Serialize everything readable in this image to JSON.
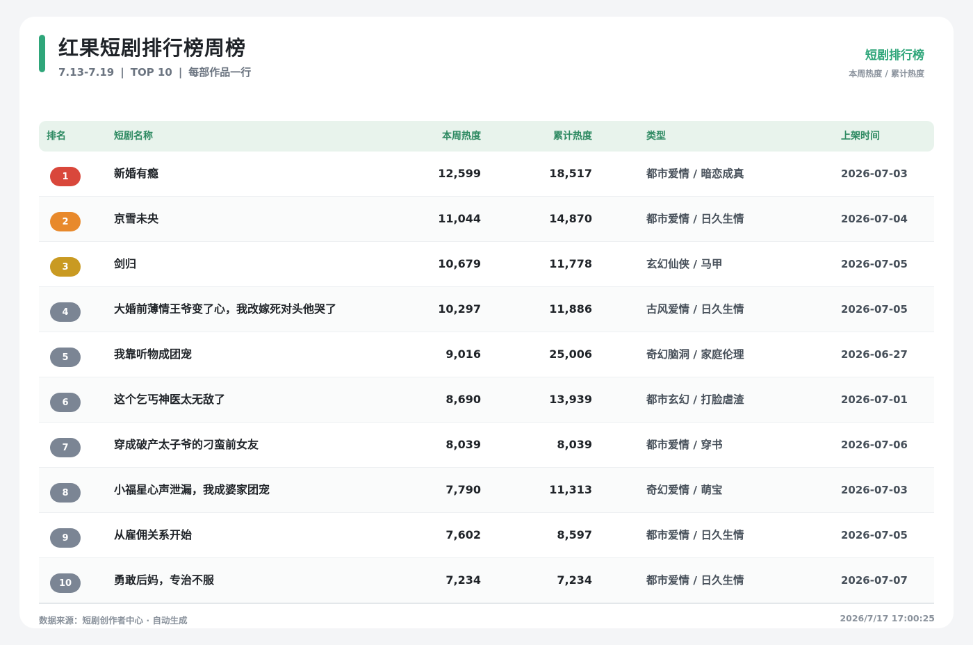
{
  "header": {
    "title": "红果短剧排行榜周榜",
    "period": "7.13-7.19",
    "scope": "TOP 10",
    "note": "每部作品一行",
    "separator": "|",
    "brand": "短剧排行榜",
    "brand_sub": "本周热度 / 累计热度"
  },
  "table": {
    "columns": {
      "rank": "排名",
      "name": "短剧名称",
      "weekly": "本周热度",
      "total": "累计热度",
      "genre": "类型",
      "date": "上架时间"
    },
    "rows": [
      {
        "rank": "1",
        "name": "新婚有瘾",
        "weekly": "12,599",
        "total": "18,517",
        "genre": "都市爱情 / 暗恋成真",
        "date": "2026-07-03",
        "badge_color": "#d9473b"
      },
      {
        "rank": "2",
        "name": "京雪未央",
        "weekly": "11,044",
        "total": "14,870",
        "genre": "都市爱情 / 日久生情",
        "date": "2026-07-04",
        "badge_color": "#e8892b"
      },
      {
        "rank": "3",
        "name": "剑归",
        "weekly": "10,679",
        "total": "11,778",
        "genre": "玄幻仙侠 / 马甲",
        "date": "2026-07-05",
        "badge_color": "#c99a22"
      },
      {
        "rank": "4",
        "name": "大婚前薄情王爷变了心，我改嫁死对头他哭了",
        "weekly": "10,297",
        "total": "11,886",
        "genre": "古风爱情 / 日久生情",
        "date": "2026-07-05",
        "badge_color": "#7b8594"
      },
      {
        "rank": "5",
        "name": "我靠听物成团宠",
        "weekly": "9,016",
        "total": "25,006",
        "genre": "奇幻脑洞 / 家庭伦理",
        "date": "2026-06-27",
        "badge_color": "#7b8594"
      },
      {
        "rank": "6",
        "name": "这个乞丐神医太无敌了",
        "weekly": "8,690",
        "total": "13,939",
        "genre": "都市玄幻 / 打脸虐渣",
        "date": "2026-07-01",
        "badge_color": "#7b8594"
      },
      {
        "rank": "7",
        "name": "穿成破产太子爷的刁蛮前女友",
        "weekly": "8,039",
        "total": "8,039",
        "genre": "都市爱情 / 穿书",
        "date": "2026-07-06",
        "badge_color": "#7b8594"
      },
      {
        "rank": "8",
        "name": "小福星心声泄漏，我成婆家团宠",
        "weekly": "7,790",
        "total": "11,313",
        "genre": "奇幻爱情 / 萌宝",
        "date": "2026-07-03",
        "badge_color": "#7b8594"
      },
      {
        "rank": "9",
        "name": "从雇佣关系开始",
        "weekly": "7,602",
        "total": "8,597",
        "genre": "都市爱情 / 日久生情",
        "date": "2026-07-05",
        "badge_color": "#7b8594"
      },
      {
        "rank": "10",
        "name": "勇敢后妈，专治不服",
        "weekly": "7,234",
        "total": "7,234",
        "genre": "都市爱情 / 日久生情",
        "date": "2026-07-07",
        "badge_color": "#7b8594"
      }
    ]
  },
  "footer": {
    "source": "数据来源：短剧创作者中心 · 自动生成",
    "timestamp": "2026/7/17 17:00:25"
  },
  "colors": {
    "accent": "#2fa67a",
    "header_bg": "#e8f3ec",
    "rank_1": "#d9473b",
    "rank_2": "#e8892b",
    "rank_3": "#c99a22",
    "rank_other": "#7b8594"
  }
}
